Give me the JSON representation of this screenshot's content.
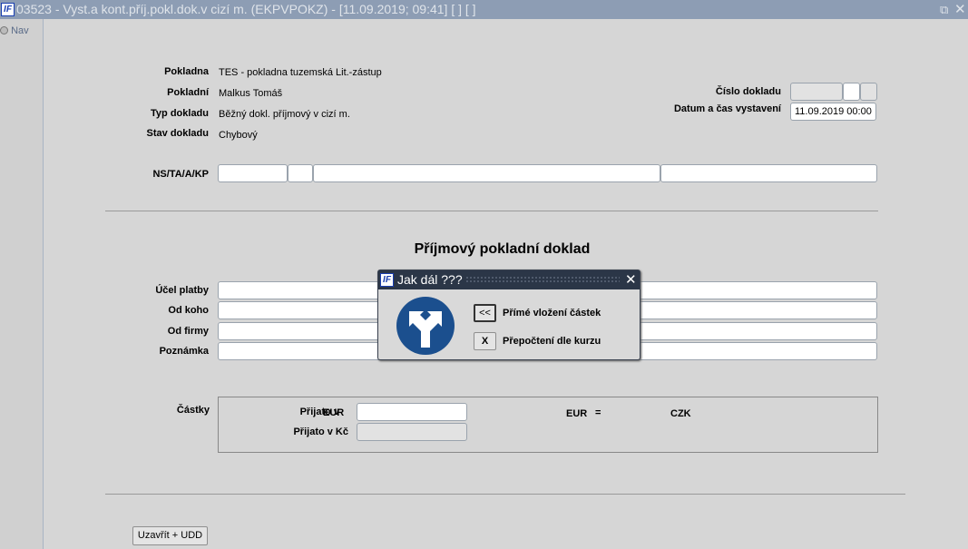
{
  "window": {
    "title": "03523 - Vyst.a kont.příj.pokl.dok.v cizí m. (EKPVPOKZ) - [11.09.2019; 09:41]  [ ]  [ ]",
    "logo": "IF"
  },
  "sidebar": {
    "nav_label": "Nav"
  },
  "header": {
    "pokladna_label": "Pokladna",
    "pokladna_value": "TES - pokladna tuzemská Lit.-zástup",
    "pokladni_label": "Pokladní",
    "pokladni_value": "Malkus Tomáš",
    "typ_label": "Typ dokladu",
    "typ_value": "Běžný dokl. příjmový v cizí m.",
    "stav_label": "Stav dokladu",
    "stav_value": "Chybový",
    "cislo_label": "Číslo dokladu",
    "datum_label": "Datum a čas vystavení",
    "datum_value": "11.09.2019 00:00",
    "ns_label": "NS/TA/A/KP"
  },
  "main": {
    "title": "Příjmový pokladní doklad",
    "ucel_label": "Účel platby",
    "od_koho_label": "Od koho",
    "od_firmy_label": "Od firmy",
    "poznamka_label": "Poznámka",
    "castky_label": "Částky",
    "prijato_v_label": "Přijato v",
    "currency": "EUR",
    "prijato_kc_label": "Přijato v Kč",
    "rate_from": "EUR",
    "rate_eq": "=",
    "rate_to": "CZK"
  },
  "footer": {
    "close_button": "Uzavřít + UDD"
  },
  "dialog": {
    "title": "Jak dál ???",
    "option1_key": "<<",
    "option1_label": "Přímé vložení částek",
    "option2_key": "X",
    "option2_label": "Přepočtení dle kurzu"
  }
}
